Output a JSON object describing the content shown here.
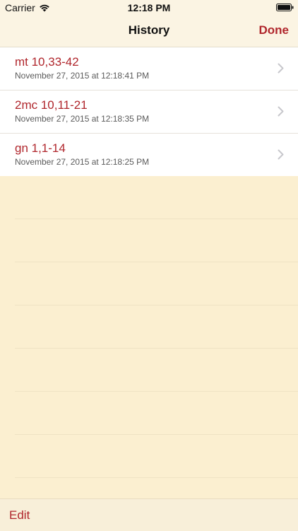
{
  "status_bar": {
    "carrier": "Carrier",
    "time": "12:18 PM",
    "icons": [
      "wifi-icon",
      "battery-icon"
    ]
  },
  "nav": {
    "title": "History",
    "done_label": "Done"
  },
  "history": [
    {
      "title": "mt 10,33-42",
      "subtitle": "November 27, 2015 at 12:18:41 PM"
    },
    {
      "title": "2mc 10,11-21",
      "subtitle": "November 27, 2015 at 12:18:35 PM"
    },
    {
      "title": "gn 1,1-14",
      "subtitle": "November 27, 2015 at 12:18:25 PM"
    }
  ],
  "toolbar": {
    "edit_label": "Edit"
  },
  "colors": {
    "accent": "#b0262c",
    "background": "#fbefd0",
    "header": "#fbf4e3"
  }
}
